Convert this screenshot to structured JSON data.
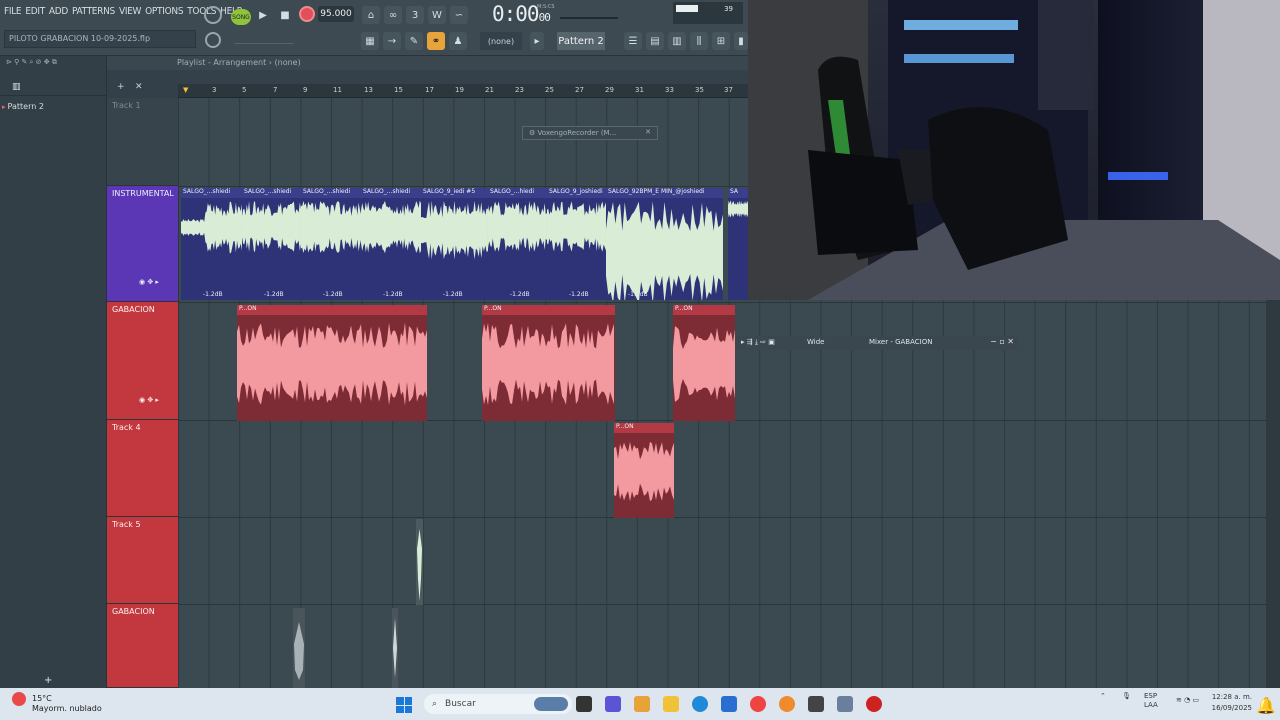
{
  "menu": [
    "FILE",
    "EDIT",
    "ADD",
    "PATTERNS",
    "VIEW",
    "OPTIONS",
    "TOOLS",
    "HELP"
  ],
  "toolbar": {
    "song_mode": "SONG",
    "tempo": "95.000",
    "time_main": "0:00",
    "time_sub": "00",
    "time_unit": "M:S:CS",
    "cpu_value": "39",
    "pattern": "Pattern 2",
    "pattern_target": "(none)"
  },
  "hint_bar": "PILOTO GRABACION 10-09-2025.flp",
  "browser": {
    "items": [
      "Pattern 2"
    ]
  },
  "playlist": {
    "title": "Playlist - Arrangement",
    "arrangement": "(none)",
    "ruler": [
      "3",
      "5",
      "7",
      "9",
      "11",
      "13",
      "15",
      "17",
      "19",
      "21",
      "23",
      "25",
      "27",
      "29",
      "31",
      "33",
      "35",
      "37"
    ]
  },
  "tracks": [
    {
      "name": "Track 1"
    },
    {
      "name": "INSTRUMENTAL"
    },
    {
      "name": "GABACION"
    },
    {
      "name": "Track 4"
    },
    {
      "name": "Track 5"
    },
    {
      "name": "GABACION"
    }
  ],
  "clips": {
    "instrumental_labels": [
      "SALGO_...shiedi",
      "SALGO_...shiedi",
      "SALGO_...shiedi",
      "SALGO_...shiedi",
      "SALGO_9_iedi #5",
      "SALGO_...hiedi",
      "SALGO_9_joshiedi",
      "SALGO_92BPM_E MIN_@joshiedi",
      "SA"
    ],
    "instrumental_gain": "-1.2dB",
    "gabacion_label": "P...ON"
  },
  "floating": {
    "voxengo": "VoxengoRecorder (M...",
    "mixer_mode": "Wide",
    "mixer_title": "Mixer - GABACION"
  },
  "taskbar": {
    "temperature": "15°C",
    "weather": "Mayorm. nublado",
    "search_placeholder": "Buscar",
    "lang": "ESP",
    "lang_region": "LAA",
    "clock_time": "12:28 a. m.",
    "clock_date": "16/09/2025"
  },
  "colors": {
    "instrumental": "#5b37b5",
    "gabacion": "#c2383e",
    "wave_green": "#d8ecd6",
    "wave_pink": "#f39aa0"
  }
}
